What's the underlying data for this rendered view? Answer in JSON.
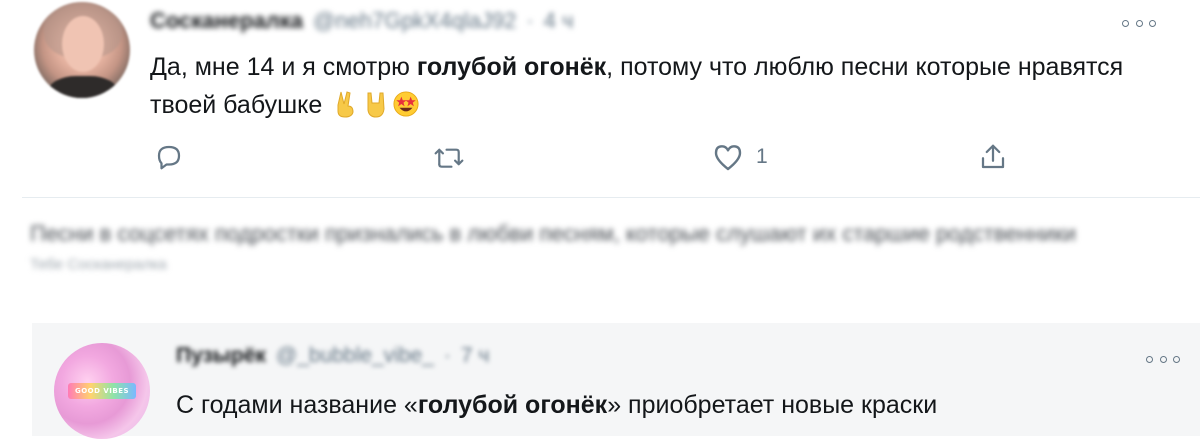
{
  "tweet1": {
    "author_name": "Сосканералка",
    "author_handle": "@neh7GpkX4qlaJ92",
    "separator": "·",
    "time": "4 ч",
    "text_before": "Да, мне 14 и я смотрю ",
    "text_bold": "голубой огонёк",
    "text_after": ",  потому что люблю песни которые нравятся твоей бабушке",
    "emojis": [
      "victory-hand-emoji",
      "rock-on-hand-emoji",
      "star-struck-emoji"
    ],
    "actions": {
      "reply_icon": "reply-icon",
      "retweet_icon": "retweet-icon",
      "like_icon": "heart-icon",
      "like_count": "1",
      "share_icon": "share-icon"
    }
  },
  "blurred_quote": {
    "text": "Песни в соцсетях подростки признались в любви песням, которые слушают их старшие родственники",
    "caption": "Тебе Сосканералка"
  },
  "tweet2": {
    "author_name": "Пузырёк",
    "author_handle": "@_bubble_vibe_",
    "separator": "·",
    "time": "7 ч",
    "avatar_badge": "GOOD VIBES",
    "text_before": "С годами название «",
    "text_bold": "голубой огонёк",
    "text_after": "» приобретает новые краски"
  },
  "colors": {
    "text_primary": "#14171a",
    "text_secondary": "#657786",
    "divider": "#e6ecf0",
    "tweet2_background": "#f5f6f7"
  }
}
